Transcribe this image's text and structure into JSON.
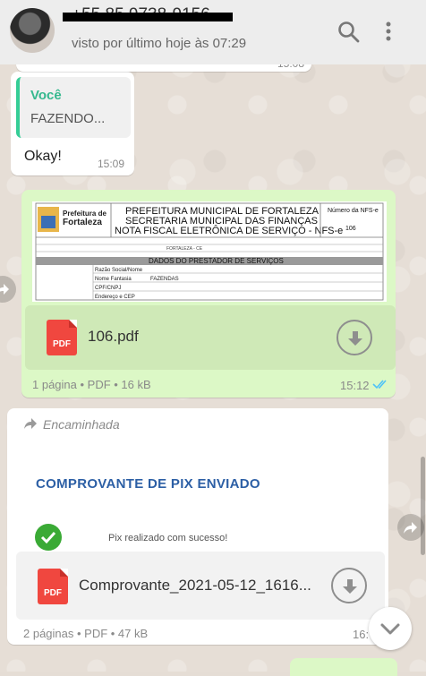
{
  "header": {
    "contact_name": "+55 85 9738-9156",
    "last_seen": "visto por último hoje às 07:29",
    "icons": [
      "search-icon",
      "more-vertical-icon"
    ]
  },
  "messages": {
    "clipped_time": "15:08",
    "reply": {
      "quoted_author": "Você",
      "quoted_text": "FAZENDO...",
      "text": "Okay!",
      "time": "15:09"
    },
    "doc1": {
      "preview": {
        "org_line1": "Prefeitura de",
        "org_line2": "Fortaleza",
        "title_line1": "PREFEITURA MUNICIPAL DE FORTALEZA",
        "title_line2": "SECRETARIA MUNICIPAL DAS FINANÇAS",
        "title_line3": "NOTA FISCAL ELETRÔNICA DE SERVIÇO - NFS-e",
        "number_label": "Número da NFS-e",
        "number_value": "106",
        "section": "DADOS DO PRESTADOR DE SERVIÇOS",
        "row_labels": [
          "Razão Social/Nome",
          "Nome Fantasia",
          "CPF/CNPJ",
          "Endereço e CEP"
        ],
        "fantasia": "FAZENDAS",
        "city": "FORTALEZA - CE"
      },
      "file_name": "106.pdf",
      "file_badge": "PDF",
      "meta": "1 página • PDF • 16 kB",
      "time": "15:12"
    },
    "doc2": {
      "forwarded": "Encaminhada",
      "preview_title": "COMPROVANTE DE PIX ENVIADO",
      "preview_sub": "Pix realizado com sucesso!",
      "file_name": "Comprovante_2021-05-12_1616...",
      "file_badge": "PDF",
      "meta": "2 páginas • PDF • 47 kB",
      "time": "16:"
    }
  },
  "colors": {
    "header_bg": "#ededed",
    "outgoing_bubble": "#dcf8c6",
    "incoming_bubble": "#ffffff",
    "read_ticks": "#4fc3f7",
    "pdf_red": "#f0473f"
  }
}
